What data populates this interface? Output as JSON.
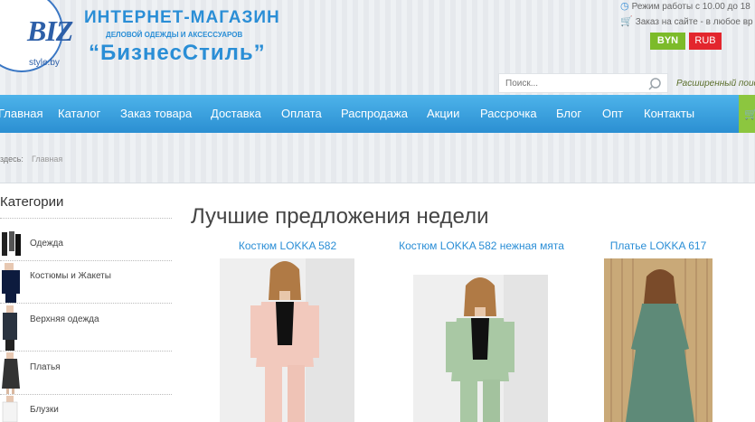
{
  "header": {
    "logo_text": "BIZ",
    "logo_sub": "style.by",
    "shop_title": "ИНТЕРНЕТ-МАГАЗИН",
    "shop_subtitle": "ДЕЛОВОЙ ОДЕЖДЫ И АКСЕССУАРОВ",
    "shop_name": "“БизнесСтиль”",
    "work_hours": "Режим работы с 10.00 до 18",
    "order_info": "Заказ на сайте - в любое вр",
    "currencies": [
      "BYN",
      "RUB"
    ],
    "search_placeholder": "Поиск...",
    "advanced_search": "Расширенный поис"
  },
  "nav": {
    "items": [
      "Главная",
      "Каталог",
      "Заказ товара",
      "Доставка",
      "Оплата",
      "Распродажа",
      "Акции",
      "Рассрочка",
      "Блог",
      "Опт",
      "Контакты"
    ],
    "active": "Главная"
  },
  "breadcrumb": {
    "label": "здесь:",
    "current": "Главная"
  },
  "sidebar": {
    "title": "Категории",
    "items": [
      "Одежда",
      "Костюмы и Жакеты",
      "Верхняя одежда",
      "Платья",
      "Блузки"
    ]
  },
  "main": {
    "title": "Лучшие предложения недели",
    "products": [
      {
        "name": "Костюм LOKKA 582",
        "color": "#f2c9bd"
      },
      {
        "name": "Костюм LOKKA 582 нежная мята",
        "color": "#a9c8a4"
      },
      {
        "name": "Платье LOKKA 617",
        "color": "#5e8a78"
      }
    ]
  },
  "colors": {
    "accent": "#2a8ed6",
    "nav": "#2b8fd2",
    "byn": "#7cbb2a",
    "rub": "#e3262e",
    "cart": "#8cc63f"
  }
}
